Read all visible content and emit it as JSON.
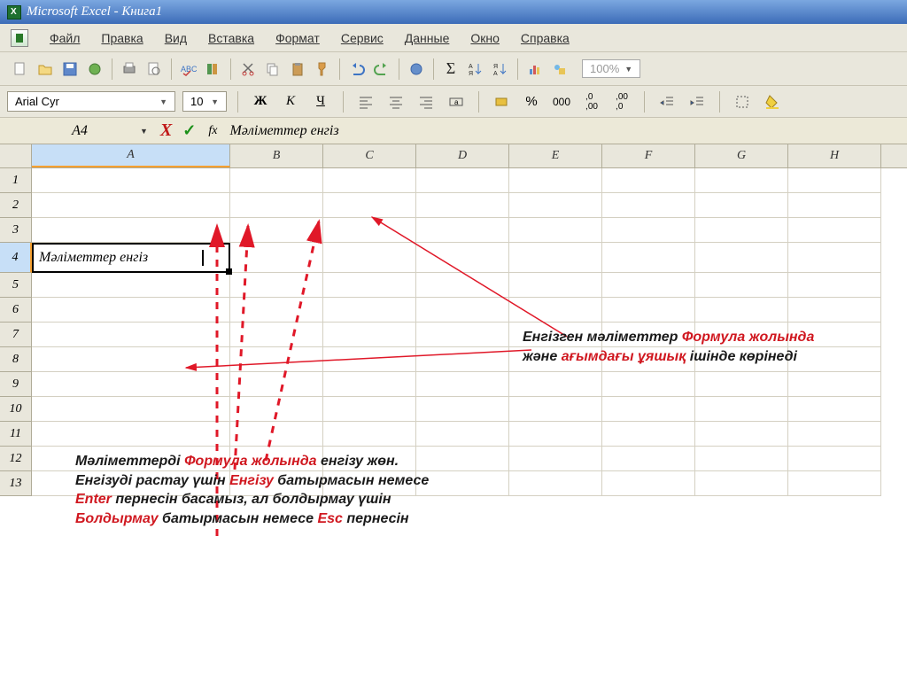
{
  "title": "Microsoft Excel - Книга1",
  "menu": {
    "file": "Файл",
    "edit": "Правка",
    "view": "Вид",
    "insert": "Вставка",
    "format": "Формат",
    "tools": "Сервис",
    "data": "Данные",
    "window": "Окно",
    "help": "Справка"
  },
  "toolbar": {
    "zoom": "100%"
  },
  "format": {
    "font": "Arial Cyr",
    "size": "10",
    "bold": "Ж",
    "italic": "К",
    "underline": "Ч"
  },
  "formula": {
    "cell": "A4",
    "fx": "fx",
    "value": "Мәліметтер енгіз"
  },
  "columns": [
    "A",
    "B",
    "C",
    "D",
    "E",
    "F",
    "G",
    "H"
  ],
  "rows": [
    "1",
    "2",
    "3",
    "4",
    "5",
    "6",
    "7",
    "8",
    "9",
    "10",
    "11",
    "12",
    "13"
  ],
  "cell_value": "Мәліметтер енгіз",
  "note1": {
    "t1": "Енгізген мәліметтер ",
    "t2": "Формула жолында",
    "t3": "және ",
    "t4": "ағымдағы ұяшық ",
    "t5": "ішінде көрінеді"
  },
  "note2": {
    "t1": "Мәліметтерді ",
    "t2": "Формула жолында ",
    "t3": "енгізу жөн.",
    "t4": "Енгізуді растау үшін ",
    "t5": "Енгізу ",
    "t6": "батырмасын немесе",
    "t7": "Enter ",
    "t8": "пернесін басамыз, ал болдырмау үшін",
    "t9": "Болдырмау ",
    "t10": "батырмасын немесе ",
    "t11": "Esc ",
    "t12": "пернесін"
  }
}
